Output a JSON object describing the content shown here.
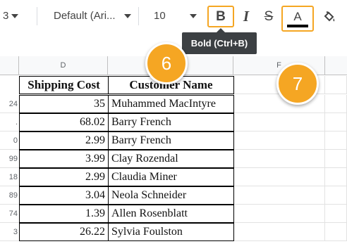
{
  "toolbar": {
    "zoom_fragment": "3",
    "font_family": "Default (Ari...",
    "font_size": "10",
    "bold_label": "B",
    "italic_label": "I",
    "strike_label": "S",
    "text_color_label": "A",
    "text_color_bar": "#000000"
  },
  "tooltip": {
    "text": "Bold (Ctrl+B)"
  },
  "callouts": [
    {
      "number": "6"
    },
    {
      "number": "7"
    }
  ],
  "columns": {
    "d": "D",
    "f": "F"
  },
  "table": {
    "headers": [
      "Shipping Cost",
      "Customer Name"
    ],
    "rows": [
      {
        "row_fragment": "24",
        "shipping": "35",
        "customer": "Muhammed MacIntyre"
      },
      {
        "row_fragment": ".",
        "shipping": "68.02",
        "customer": "Barry French"
      },
      {
        "row_fragment": "0",
        "shipping": "2.99",
        "customer": "Barry French"
      },
      {
        "row_fragment": "99",
        "shipping": "3.99",
        "customer": "Clay Rozendal"
      },
      {
        "row_fragment": "18",
        "shipping": "2.99",
        "customer": "Claudia Miner"
      },
      {
        "row_fragment": "89",
        "shipping": "3.04",
        "customer": "Neola Schneider"
      },
      {
        "row_fragment": "74",
        "shipping": "1.39",
        "customer": "Allen Rosenblatt"
      },
      {
        "row_fragment": "3",
        "shipping": "26.22",
        "customer": "Sylvia Foulston"
      }
    ]
  },
  "colors": {
    "accent": "#f5a623",
    "tooltip_bg": "#3c4043"
  }
}
